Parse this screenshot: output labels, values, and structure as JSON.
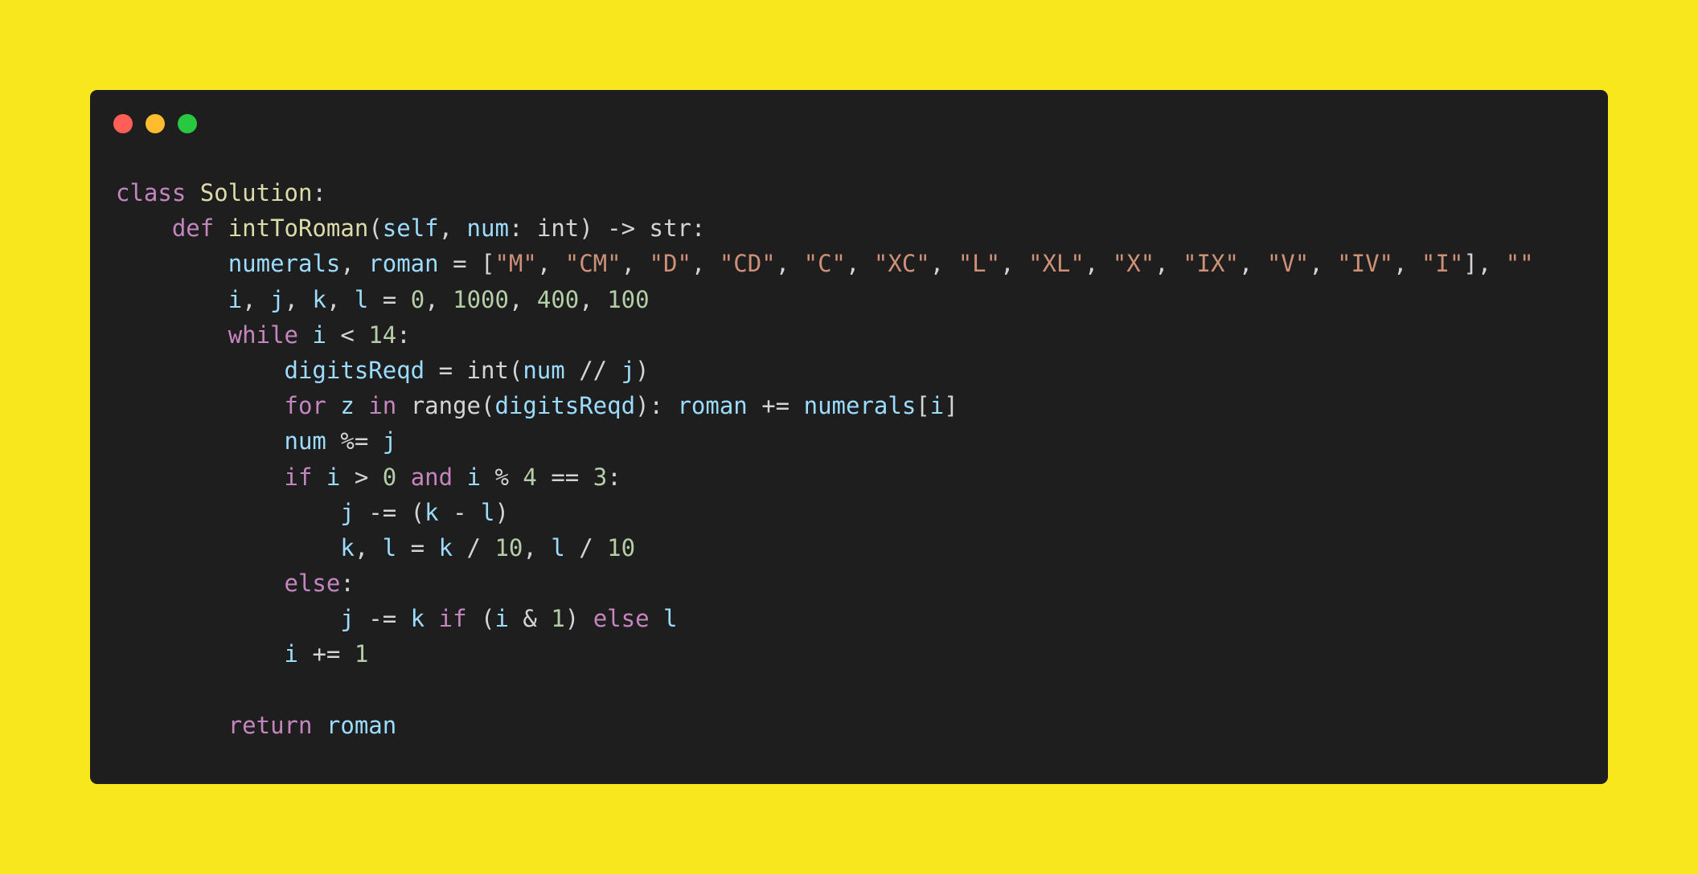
{
  "window": {
    "controls": [
      {
        "name": "close",
        "color": "#ff5f57"
      },
      {
        "name": "minimize",
        "color": "#febc2e"
      },
      {
        "name": "maximize",
        "color": "#28c840"
      }
    ]
  },
  "colors": {
    "background": "#f9e71e",
    "editor": "#1e1e1e",
    "keyword": "#c586c0",
    "class_name": "#dcdcaa",
    "function": "#dcdcaa",
    "variable": "#9cdcfe",
    "string": "#ce9178",
    "number": "#b5cea8",
    "plain": "#d4d4d4"
  },
  "code": {
    "language": "python",
    "lines": [
      {
        "indent": 0,
        "tokens": [
          {
            "t": "class",
            "c": "keyword"
          },
          {
            "t": " ",
            "c": "plain"
          },
          {
            "t": "Solution",
            "c": "class_name"
          },
          {
            "t": ":",
            "c": "plain"
          }
        ]
      },
      {
        "indent": 4,
        "tokens": [
          {
            "t": "def",
            "c": "keyword"
          },
          {
            "t": " ",
            "c": "plain"
          },
          {
            "t": "intToRoman",
            "c": "function"
          },
          {
            "t": "(",
            "c": "plain"
          },
          {
            "t": "self",
            "c": "variable"
          },
          {
            "t": ", ",
            "c": "plain"
          },
          {
            "t": "num",
            "c": "variable"
          },
          {
            "t": ": int) -> str:",
            "c": "plain"
          }
        ]
      },
      {
        "indent": 8,
        "tokens": [
          {
            "t": "numerals",
            "c": "variable"
          },
          {
            "t": ", ",
            "c": "plain"
          },
          {
            "t": "roman",
            "c": "variable"
          },
          {
            "t": " = [",
            "c": "plain"
          },
          {
            "t": "\"M\"",
            "c": "string"
          },
          {
            "t": ", ",
            "c": "plain"
          },
          {
            "t": "\"CM\"",
            "c": "string"
          },
          {
            "t": ", ",
            "c": "plain"
          },
          {
            "t": "\"D\"",
            "c": "string"
          },
          {
            "t": ", ",
            "c": "plain"
          },
          {
            "t": "\"CD\"",
            "c": "string"
          },
          {
            "t": ", ",
            "c": "plain"
          },
          {
            "t": "\"C\"",
            "c": "string"
          },
          {
            "t": ", ",
            "c": "plain"
          },
          {
            "t": "\"XC\"",
            "c": "string"
          },
          {
            "t": ", ",
            "c": "plain"
          },
          {
            "t": "\"L\"",
            "c": "string"
          },
          {
            "t": ", ",
            "c": "plain"
          },
          {
            "t": "\"XL\"",
            "c": "string"
          },
          {
            "t": ", ",
            "c": "plain"
          },
          {
            "t": "\"X\"",
            "c": "string"
          },
          {
            "t": ", ",
            "c": "plain"
          },
          {
            "t": "\"IX\"",
            "c": "string"
          },
          {
            "t": ", ",
            "c": "plain"
          },
          {
            "t": "\"V\"",
            "c": "string"
          },
          {
            "t": ", ",
            "c": "plain"
          },
          {
            "t": "\"IV\"",
            "c": "string"
          },
          {
            "t": ", ",
            "c": "plain"
          },
          {
            "t": "\"I\"",
            "c": "string"
          },
          {
            "t": "], ",
            "c": "plain"
          },
          {
            "t": "\"\"",
            "c": "string"
          }
        ]
      },
      {
        "indent": 8,
        "tokens": [
          {
            "t": "i",
            "c": "variable"
          },
          {
            "t": ", ",
            "c": "plain"
          },
          {
            "t": "j",
            "c": "variable"
          },
          {
            "t": ", ",
            "c": "plain"
          },
          {
            "t": "k",
            "c": "variable"
          },
          {
            "t": ", ",
            "c": "plain"
          },
          {
            "t": "l",
            "c": "variable"
          },
          {
            "t": " = ",
            "c": "plain"
          },
          {
            "t": "0",
            "c": "number"
          },
          {
            "t": ", ",
            "c": "plain"
          },
          {
            "t": "1000",
            "c": "number"
          },
          {
            "t": ", ",
            "c": "plain"
          },
          {
            "t": "400",
            "c": "number"
          },
          {
            "t": ", ",
            "c": "plain"
          },
          {
            "t": "100",
            "c": "number"
          }
        ]
      },
      {
        "indent": 8,
        "tokens": [
          {
            "t": "while",
            "c": "keyword"
          },
          {
            "t": " ",
            "c": "plain"
          },
          {
            "t": "i",
            "c": "variable"
          },
          {
            "t": " < ",
            "c": "plain"
          },
          {
            "t": "14",
            "c": "number"
          },
          {
            "t": ":",
            "c": "plain"
          }
        ]
      },
      {
        "indent": 12,
        "tokens": [
          {
            "t": "digitsReqd",
            "c": "variable"
          },
          {
            "t": " = int(",
            "c": "plain"
          },
          {
            "t": "num",
            "c": "variable"
          },
          {
            "t": " // ",
            "c": "plain"
          },
          {
            "t": "j",
            "c": "variable"
          },
          {
            "t": ")",
            "c": "plain"
          }
        ]
      },
      {
        "indent": 12,
        "tokens": [
          {
            "t": "for",
            "c": "keyword"
          },
          {
            "t": " ",
            "c": "plain"
          },
          {
            "t": "z",
            "c": "variable"
          },
          {
            "t": " ",
            "c": "plain"
          },
          {
            "t": "in",
            "c": "keyword"
          },
          {
            "t": " range(",
            "c": "plain"
          },
          {
            "t": "digitsReqd",
            "c": "variable"
          },
          {
            "t": "): ",
            "c": "plain"
          },
          {
            "t": "roman",
            "c": "variable"
          },
          {
            "t": " += ",
            "c": "plain"
          },
          {
            "t": "numerals",
            "c": "variable"
          },
          {
            "t": "[",
            "c": "plain"
          },
          {
            "t": "i",
            "c": "variable"
          },
          {
            "t": "]",
            "c": "plain"
          }
        ]
      },
      {
        "indent": 12,
        "tokens": [
          {
            "t": "num",
            "c": "variable"
          },
          {
            "t": " %= ",
            "c": "plain"
          },
          {
            "t": "j",
            "c": "variable"
          }
        ]
      },
      {
        "indent": 12,
        "tokens": [
          {
            "t": "if",
            "c": "keyword"
          },
          {
            "t": " ",
            "c": "plain"
          },
          {
            "t": "i",
            "c": "variable"
          },
          {
            "t": " > ",
            "c": "plain"
          },
          {
            "t": "0",
            "c": "number"
          },
          {
            "t": " ",
            "c": "plain"
          },
          {
            "t": "and",
            "c": "keyword"
          },
          {
            "t": " ",
            "c": "plain"
          },
          {
            "t": "i",
            "c": "variable"
          },
          {
            "t": " % ",
            "c": "plain"
          },
          {
            "t": "4",
            "c": "number"
          },
          {
            "t": " == ",
            "c": "plain"
          },
          {
            "t": "3",
            "c": "number"
          },
          {
            "t": ":",
            "c": "plain"
          }
        ]
      },
      {
        "indent": 16,
        "tokens": [
          {
            "t": "j",
            "c": "variable"
          },
          {
            "t": " -= (",
            "c": "plain"
          },
          {
            "t": "k",
            "c": "variable"
          },
          {
            "t": " - ",
            "c": "plain"
          },
          {
            "t": "l",
            "c": "variable"
          },
          {
            "t": ")",
            "c": "plain"
          }
        ]
      },
      {
        "indent": 16,
        "tokens": [
          {
            "t": "k",
            "c": "variable"
          },
          {
            "t": ", ",
            "c": "plain"
          },
          {
            "t": "l",
            "c": "variable"
          },
          {
            "t": " = ",
            "c": "plain"
          },
          {
            "t": "k",
            "c": "variable"
          },
          {
            "t": " / ",
            "c": "plain"
          },
          {
            "t": "10",
            "c": "number"
          },
          {
            "t": ", ",
            "c": "plain"
          },
          {
            "t": "l",
            "c": "variable"
          },
          {
            "t": " / ",
            "c": "plain"
          },
          {
            "t": "10",
            "c": "number"
          }
        ]
      },
      {
        "indent": 12,
        "tokens": [
          {
            "t": "else",
            "c": "keyword"
          },
          {
            "t": ":",
            "c": "plain"
          }
        ]
      },
      {
        "indent": 16,
        "tokens": [
          {
            "t": "j",
            "c": "variable"
          },
          {
            "t": " -= ",
            "c": "plain"
          },
          {
            "t": "k",
            "c": "variable"
          },
          {
            "t": " ",
            "c": "plain"
          },
          {
            "t": "if",
            "c": "keyword"
          },
          {
            "t": " (",
            "c": "plain"
          },
          {
            "t": "i",
            "c": "variable"
          },
          {
            "t": " & ",
            "c": "plain"
          },
          {
            "t": "1",
            "c": "number"
          },
          {
            "t": ") ",
            "c": "plain"
          },
          {
            "t": "else",
            "c": "keyword"
          },
          {
            "t": " ",
            "c": "plain"
          },
          {
            "t": "l",
            "c": "variable"
          }
        ]
      },
      {
        "indent": 12,
        "tokens": [
          {
            "t": "i",
            "c": "variable"
          },
          {
            "t": " += ",
            "c": "plain"
          },
          {
            "t": "1",
            "c": "number"
          }
        ]
      },
      {
        "indent": 0,
        "tokens": []
      },
      {
        "indent": 8,
        "tokens": [
          {
            "t": "return",
            "c": "keyword"
          },
          {
            "t": " ",
            "c": "plain"
          },
          {
            "t": "roman",
            "c": "variable"
          }
        ]
      }
    ]
  }
}
